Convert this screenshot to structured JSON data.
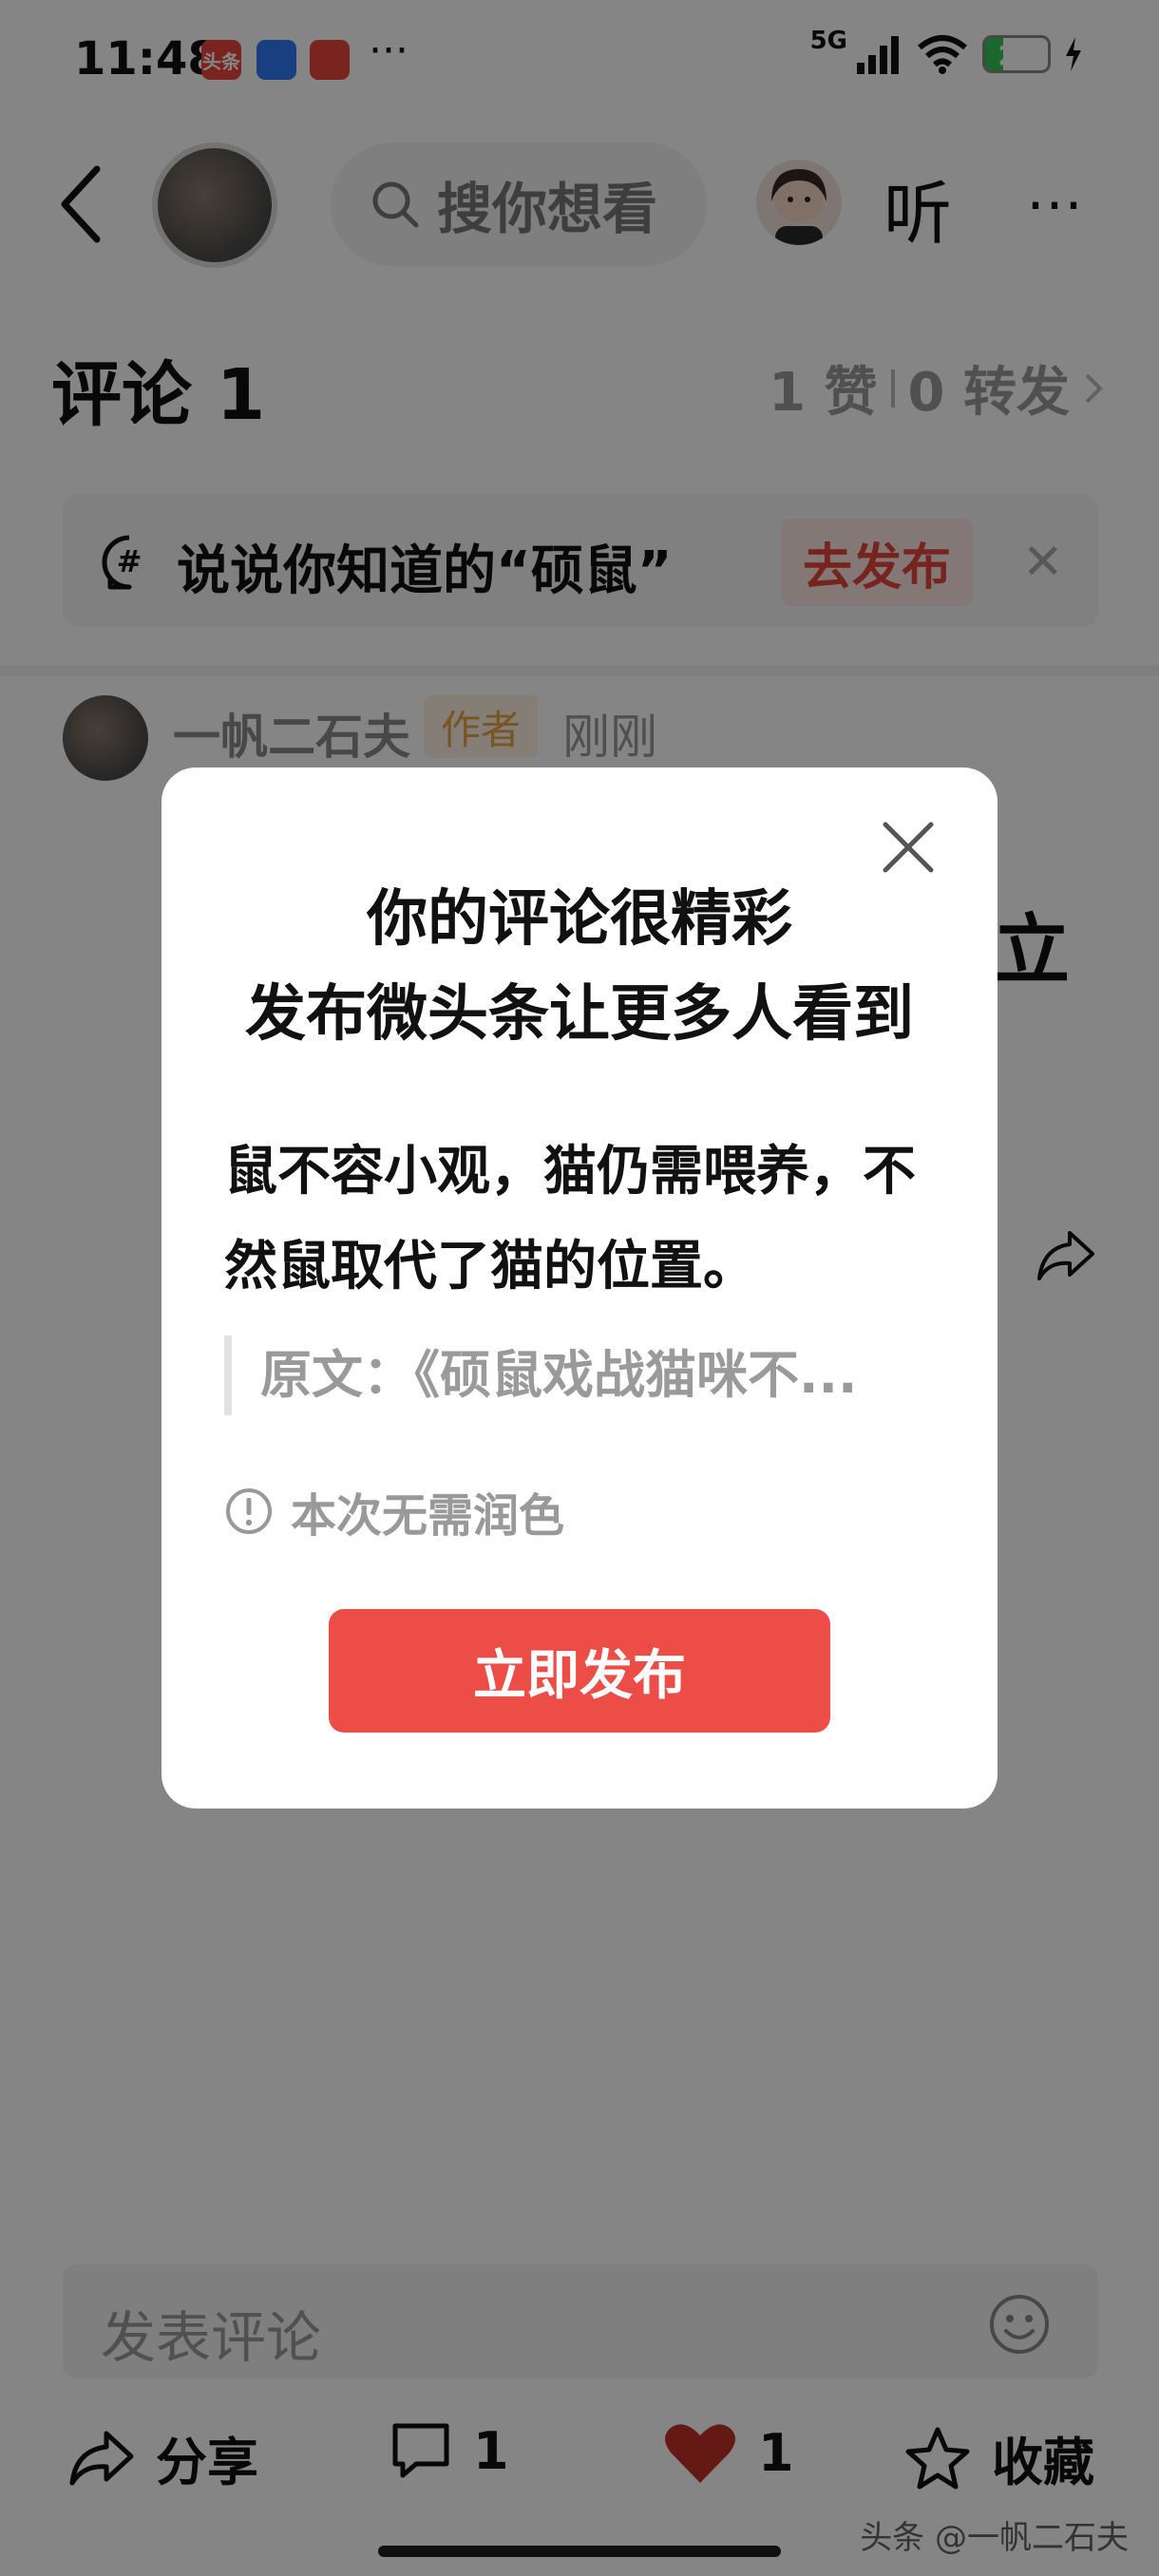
{
  "status_bar": {
    "time": "11:48",
    "network": "5G",
    "battery": "29",
    "battery_level": 0.29,
    "app_icons": [
      {
        "name": "toutiao-app-icon",
        "color": "#e8453c"
      },
      {
        "name": "browser-app-icon",
        "color": "#2f7cf6"
      },
      {
        "name": "heart-app-icon",
        "color": "#e8453c"
      }
    ]
  },
  "header": {
    "search_placeholder": "搜你想看",
    "listen_label": "听",
    "more_label": "⋯"
  },
  "comments_section": {
    "title": "评论 1",
    "likes": "1 赞",
    "shares": "0 转发",
    "topic_prompt": "说说你知道的“硕鼠”",
    "topic_button": "去发布",
    "close_glyph": "✕"
  },
  "comment_item": {
    "author": "一帆二石夫",
    "badge": "作者",
    "time": "刚刚",
    "text_peek": "立"
  },
  "bottom_bar": {
    "input_placeholder": "发表评论",
    "share_label": "分享",
    "comment_count": "1",
    "like_count": "1",
    "favorite_label": "收藏",
    "watermark": "头条 @一帆二石夫"
  },
  "modal": {
    "title_line1": "你的评论很精彩",
    "title_line2": "发布微头条让更多人看到",
    "comment_text": "鼠不容小观，猫仍需喂养，不然鼠取代了猫的位置。",
    "original_quote": "原文：《硕鼠戏战猫咪不...",
    "notice": "本次无需润色",
    "publish_button": "立即发布"
  },
  "colors": {
    "accent_red": "#ec4e47",
    "like_red": "#c0302a",
    "author_badge": "#e4a347"
  }
}
